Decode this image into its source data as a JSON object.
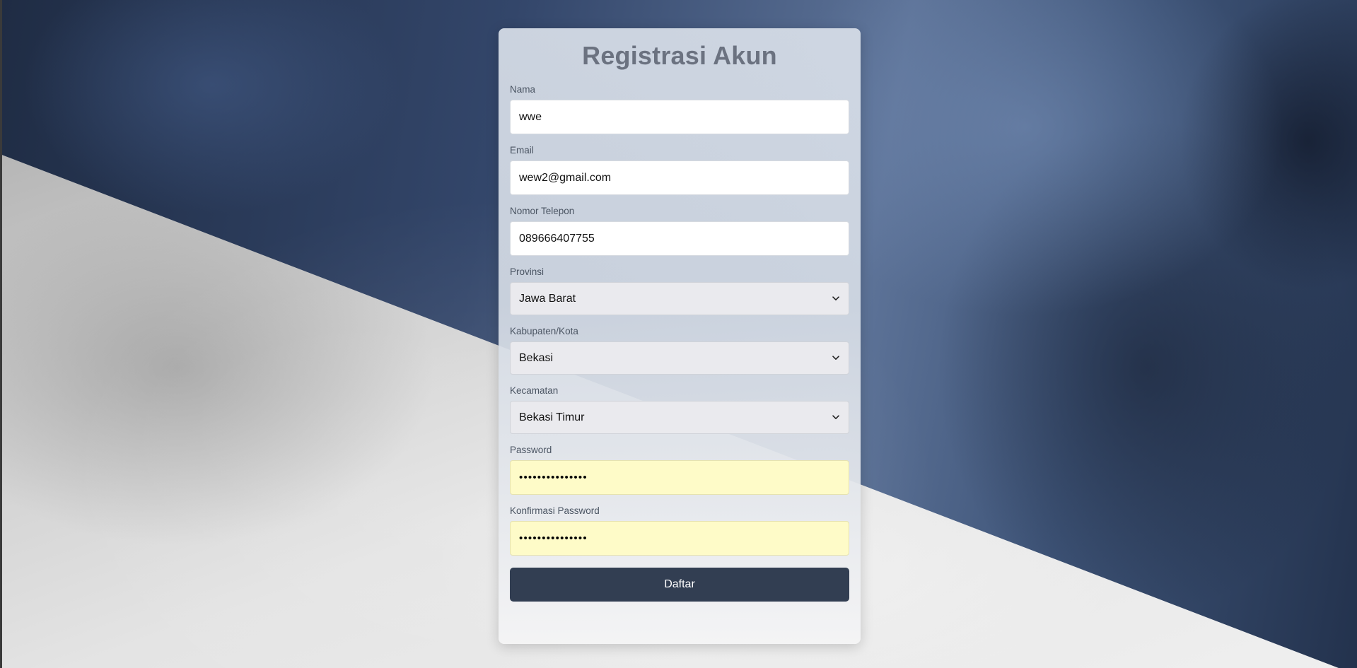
{
  "form": {
    "title": "Registrasi Akun",
    "fields": {
      "nama": {
        "label": "Nama",
        "value": "wwe"
      },
      "email": {
        "label": "Email",
        "value": "wew2@gmail.com"
      },
      "telepon": {
        "label": "Nomor Telepon",
        "value": "089666407755"
      },
      "provinsi": {
        "label": "Provinsi",
        "selected": "Jawa Barat",
        "icon": "chevron-down-icon"
      },
      "kabupaten": {
        "label": "Kabupaten/Kota",
        "selected": "Bekasi",
        "icon": "chevron-down-icon"
      },
      "kecamatan": {
        "label": "Kecamatan",
        "selected": "Bekasi Timur",
        "icon": "chevron-down-icon"
      },
      "password": {
        "label": "Password",
        "masked": "•••••••••••••••"
      },
      "konfirmasi": {
        "label": "Konfirmasi Password",
        "masked": "•••••••••••••••"
      }
    },
    "submit_label": "Daftar"
  },
  "colors": {
    "title": "#6b7280",
    "button": "#323e52",
    "autofill": "#fefbc8",
    "select_bg": "#eaeaee"
  }
}
